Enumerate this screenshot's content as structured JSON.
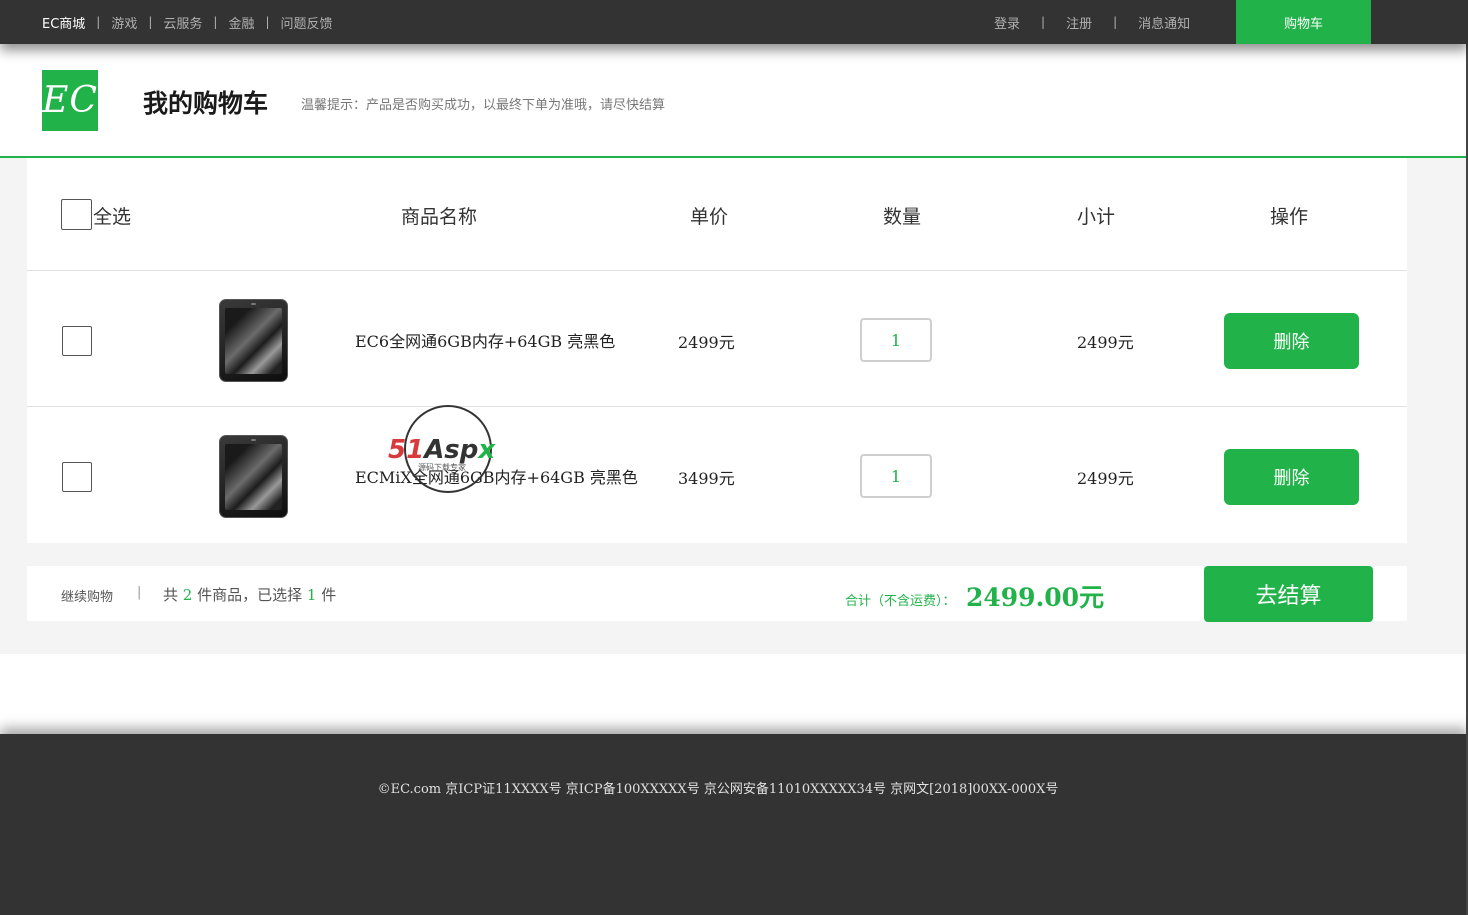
{
  "topbar": {
    "nav": [
      "EC商城",
      "游戏",
      "云服务",
      "金融",
      "问题反馈"
    ],
    "separator": "|",
    "login": "登录",
    "register": "注册",
    "messages": "消息通知",
    "cart": "购物车"
  },
  "header": {
    "logo_text": "EC",
    "title": "我的购物车",
    "tip": "温馨提示：产品是否购买成功，以最终下单为准哦，请尽快结算"
  },
  "table": {
    "select_all": "全选",
    "columns": [
      "商品名称",
      "单价",
      "数量",
      "小计",
      "操作"
    ],
    "rows": [
      {
        "name": "EC6全网通6GB内存+64GB 亮黑色",
        "price": "2499元",
        "qty": "1",
        "subtotal": "2499元",
        "action": "删除"
      },
      {
        "name": "ECMiX全网通6GB内存+64GB 亮黑色",
        "price": "3499元",
        "qty": "1",
        "subtotal": "2499元",
        "action": "删除"
      }
    ]
  },
  "summary": {
    "continue": "继续购物",
    "separator": "|",
    "count_prefix": "共",
    "total_count": "2",
    "count_mid": "件商品，已选择",
    "selected_count": "1",
    "count_suffix": "件",
    "total_label": "合计（不含运费）：",
    "total_value": "2499.00元",
    "checkout": "去结算"
  },
  "watermark": {
    "brand": "51Aspx",
    "slogan": "源码下载专家"
  },
  "footer": {
    "copyright": "©EC.com 京ICP证11XXXX号 京ICP备100XXXXX号 京公网安备11010XXXXX34号 京网文[2018]00XX-000X号"
  },
  "colors": {
    "accent": "#21b24a",
    "dark": "#333333",
    "watermark_red": "#d8393b"
  }
}
